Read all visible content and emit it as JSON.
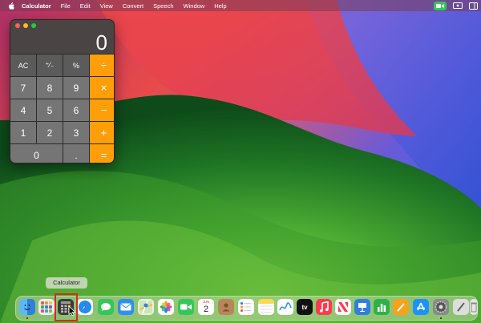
{
  "menubar": {
    "app_name": "Calculator",
    "items": [
      "File",
      "Edit",
      "View",
      "Convert",
      "Speech",
      "Window",
      "Help"
    ]
  },
  "calculator": {
    "display": "0",
    "keys": [
      {
        "label": "AC",
        "kind": "fn"
      },
      {
        "label": "⁺∕₋",
        "kind": "fn"
      },
      {
        "label": "%",
        "kind": "fn"
      },
      {
        "label": "÷",
        "kind": "op"
      },
      {
        "label": "7",
        "kind": "num"
      },
      {
        "label": "8",
        "kind": "num"
      },
      {
        "label": "9",
        "kind": "num"
      },
      {
        "label": "×",
        "kind": "op"
      },
      {
        "label": "4",
        "kind": "num"
      },
      {
        "label": "5",
        "kind": "num"
      },
      {
        "label": "6",
        "kind": "num"
      },
      {
        "label": "−",
        "kind": "op"
      },
      {
        "label": "1",
        "kind": "num"
      },
      {
        "label": "2",
        "kind": "num"
      },
      {
        "label": "3",
        "kind": "num"
      },
      {
        "label": "+",
        "kind": "op"
      },
      {
        "label": "0",
        "kind": "num"
      },
      {
        "label": ".",
        "kind": "num"
      },
      {
        "label": "=",
        "kind": "op"
      }
    ]
  },
  "tooltip": {
    "text": "Calculator"
  },
  "dock": {
    "calendar_month": "JUN",
    "calendar_day": "2",
    "tv_label": "tv",
    "icons": [
      {
        "name": "finder-icon",
        "color": "#2f8ff0"
      },
      {
        "name": "launchpad-icon",
        "color": "#e8e8e8"
      },
      {
        "name": "calculator-icon",
        "color": "#3c3c3c"
      },
      {
        "name": "safari-icon",
        "color": "#1a8cf0"
      },
      {
        "name": "messages-icon",
        "color": "#34c759"
      },
      {
        "name": "mail-icon",
        "color": "#2f8ff0"
      },
      {
        "name": "maps-icon",
        "color": "#5ab66a"
      },
      {
        "name": "photos-icon",
        "color": "#ffffff"
      },
      {
        "name": "facetime-icon",
        "color": "#34c759"
      },
      {
        "name": "calendar-icon",
        "color": "#ffffff"
      },
      {
        "name": "contacts-icon",
        "color": "#b9865a"
      },
      {
        "name": "reminders-icon",
        "color": "#ffffff"
      },
      {
        "name": "notes-icon",
        "color": "#ffd84d"
      },
      {
        "name": "freeform-icon",
        "color": "#ffffff"
      },
      {
        "name": "apple-tv-icon",
        "color": "#111111"
      },
      {
        "name": "music-icon",
        "color": "#fa3c50"
      },
      {
        "name": "news-icon",
        "color": "#ffffff"
      },
      {
        "name": "keynote-icon",
        "color": "#2f7fe0"
      },
      {
        "name": "numbers-icon",
        "color": "#2fb04a"
      },
      {
        "name": "pages-icon",
        "color": "#f7a21b"
      },
      {
        "name": "app-store-icon",
        "color": "#1e90ff"
      },
      {
        "name": "system-settings-icon",
        "color": "#8a8a8a"
      },
      {
        "name": "script-editor-icon",
        "color": "#dddddd"
      },
      {
        "name": "trash-icon",
        "color": "#e6e6e6"
      }
    ]
  }
}
